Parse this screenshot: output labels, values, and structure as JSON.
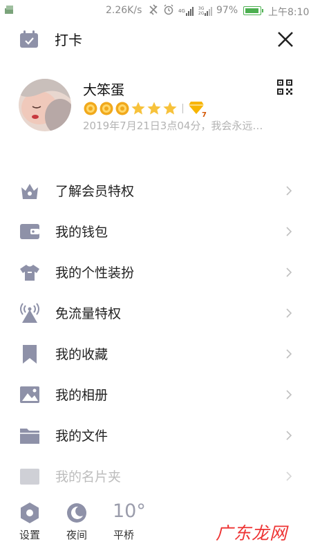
{
  "status_bar": {
    "net_speed": "2.26K/s",
    "net1": "4G",
    "net2a": "3G",
    "net2b": "2G",
    "battery": "97%",
    "battery_level": 0.97,
    "time": "上午8:10"
  },
  "header": {
    "title": "打卡"
  },
  "profile": {
    "name": "大笨蛋",
    "signature": "2019年7月21日3点04分，我会永远…",
    "level_badges": [
      "sun",
      "sun",
      "sun",
      "star",
      "star",
      "star"
    ],
    "vip_level": "7"
  },
  "menu": [
    {
      "label": "了解会员特权",
      "icon": "crown-icon"
    },
    {
      "label": "我的钱包",
      "icon": "wallet-icon"
    },
    {
      "label": "我的个性装扮",
      "icon": "shirt-icon"
    },
    {
      "label": "免流量特权",
      "icon": "signal-tower-icon"
    },
    {
      "label": "我的收藏",
      "icon": "bookmark-icon"
    },
    {
      "label": "我的相册",
      "icon": "photo-icon"
    },
    {
      "label": "我的文件",
      "icon": "folder-icon"
    },
    {
      "label": "我的名片夹",
      "icon": "card-holder-icon"
    }
  ],
  "bottom": {
    "settings": "设置",
    "night": "夜间",
    "temperature": "10°",
    "city": "平桥"
  },
  "watermark": "广东龙网",
  "colors": {
    "icon": "#8e91a8",
    "star": "#f7c23b",
    "sun": "#f1a91c",
    "battery": "#4caf50"
  }
}
